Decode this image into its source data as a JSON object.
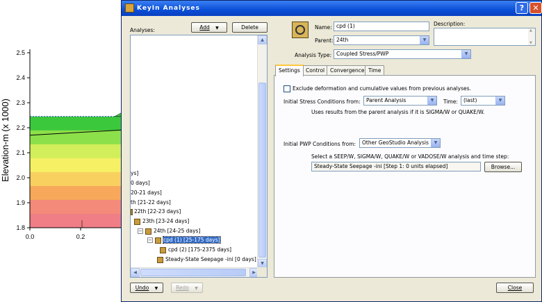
{
  "background_plot": {
    "ylabel": "Elevation-m (x 1000)",
    "yticks": [
      "2.5",
      "2.4",
      "2.3",
      "2.2",
      "2.1",
      "2.0",
      "1.9",
      "1.8"
    ],
    "xticks": [
      "0.0",
      "0.2"
    ],
    "bands": [
      "#3cc83c",
      "#8ce04a",
      "#d2ee5a",
      "#f5f064",
      "#f8d060",
      "#f7a85a",
      "#f48a7a",
      "#f07e86"
    ]
  },
  "window": {
    "title": "KeyIn Analyses",
    "help": "?",
    "close": "✕"
  },
  "left": {
    "analyses_label": "Analyses:",
    "add_label": "Add",
    "delete_label": "Delete",
    "undo_label": "Undo",
    "redo_label": "Redo",
    "tree": [
      {
        "text": "ys]"
      },
      {
        "text": "0 days]"
      },
      {
        "text": "20-21 days]"
      },
      {
        "text": "th [21-22 days]"
      },
      {
        "text": "22th [22-23 days]"
      },
      {
        "text": "23th [23-24 days]"
      },
      {
        "text": "24th [24-25 days]"
      },
      {
        "text": "cpd (1) [25-175 days]"
      },
      {
        "text": "cpd (2) [175-2375 days]"
      },
      {
        "text": "Steady-State Seepage -ini [0 days]"
      }
    ]
  },
  "right": {
    "name_label": "Name:",
    "name_value": "cpd (1)",
    "parent_label": "Parent:",
    "parent_value": "24th",
    "description_label": "Description:",
    "analysis_type_label": "Analysis Type:",
    "analysis_type_value": "Coupled Stress/PWP",
    "tabs": [
      "Settings",
      "Control",
      "Convergence",
      "Time"
    ],
    "settings": {
      "exclude_label": "Exclude deformation and cumulative values from previous analyses.",
      "initial_stress_label": "Initial Stress Conditions from:",
      "initial_stress_value": "Parent Analysis",
      "time_label": "Time:",
      "time_value": "(last)",
      "parent_note": "Uses results from the parent analysis if it is SIGMA/W or QUAKE/W.",
      "initial_pwp_label": "Initial PWP Conditions from:",
      "initial_pwp_value": "Other GeoStudio Analysis",
      "select_note": "Select a SEEP/W, SIGMA/W, QUAKE/W or VADOSE/W analysis and time step:",
      "source_value": "Steady-State Seepage -ini [Step 1: 0 units elapsed]",
      "browse_label": "Browse..."
    },
    "close_label": "Close"
  }
}
